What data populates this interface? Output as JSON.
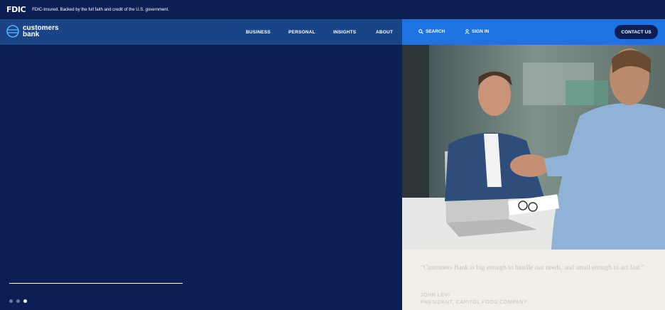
{
  "fdic": {
    "logo": "FDIC",
    "notice": "FDIC-Insured. Backed by the full faith and credit of the U.S. government."
  },
  "header": {
    "brand_line1": "customers",
    "brand_line2": "bank",
    "nav": [
      "BUSINESS",
      "PERSONAL",
      "INSIGHTS",
      "ABOUT"
    ],
    "search_label": "SEARCH",
    "signin_label": "SIGN IN",
    "contact_label": "CONTACT US"
  },
  "hero": {
    "carousel_dots": 3,
    "active_dot": 3,
    "quote": "“Customers Bank is big enough to handle our needs, and small enough to act fast.”",
    "person_name": "JOHN LEVI",
    "person_title": "PRESIDENT, CAPITOL FOOD COMPANY"
  },
  "colors": {
    "navy": "#0b1f54",
    "header_blue": "#1b4486",
    "accent_blue": "#1e73e0",
    "quote_bg": "#f3ede8"
  }
}
